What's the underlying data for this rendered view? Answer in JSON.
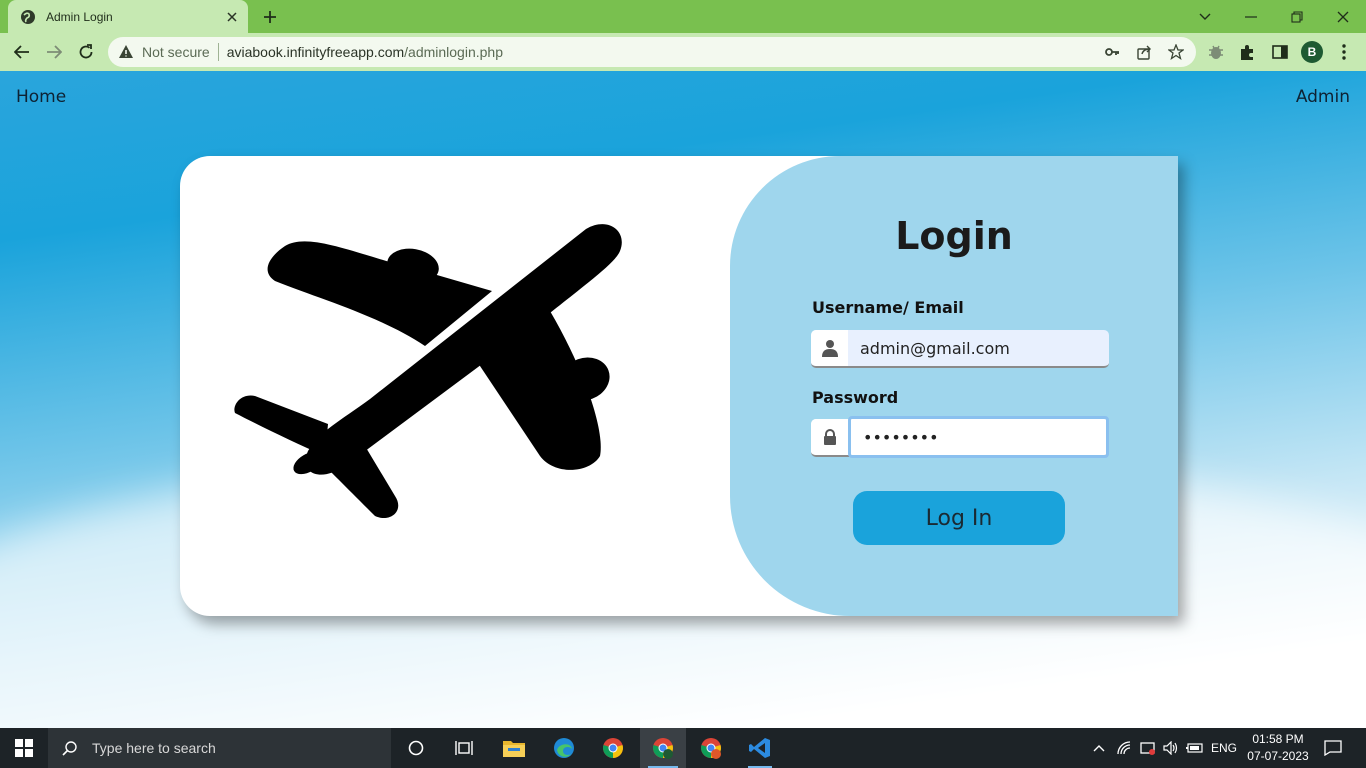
{
  "browser": {
    "tab_title": "Admin Login",
    "security_label": "Not secure",
    "url_domain": "aviabook.infinityfreeapp.com",
    "url_path": "/adminlogin.php",
    "profile_initial": "B"
  },
  "nav": {
    "home": "Home",
    "admin": "Admin"
  },
  "login": {
    "title": "Login",
    "username_label": "Username/ Email",
    "username_value": "admin@gmail.com",
    "password_label": "Password",
    "password_value": "••••••••",
    "button": "Log In"
  },
  "taskbar": {
    "search_placeholder": "Type here to search",
    "language": "ENG",
    "time": "01:58 PM",
    "date": "07-07-2023"
  },
  "colors": {
    "tab_strip": "#79c04f",
    "toolbar": "#c6e9b2",
    "accent": "#1aa3db",
    "panel": "#9fd6ed"
  }
}
